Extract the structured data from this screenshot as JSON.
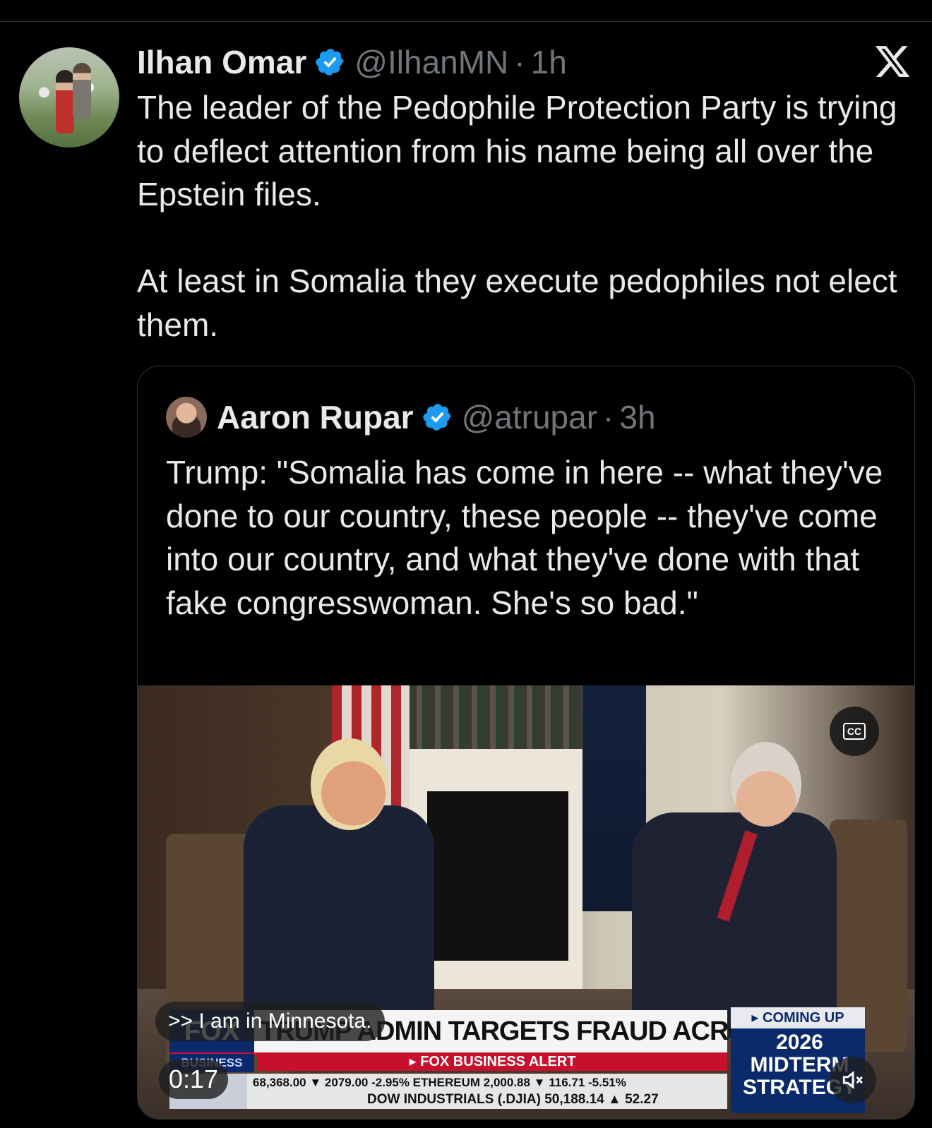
{
  "post": {
    "author_name": "Ilhan Omar",
    "author_handle": "@IlhanMN",
    "separator": "·",
    "time": "1h",
    "text_p1": "The leader of the Pedophile Protection Party is trying to deflect attention from his name being all over the Epstein files.",
    "text_p2": "At least in Somalia they execute pedophiles not elect them."
  },
  "quote": {
    "author_name": "Aaron Rupar",
    "author_handle": "@atrupar",
    "separator": "·",
    "time": "3h",
    "text": "Trump: \"Somalia has come in here -- what they've done to our country, these people -- they've come into our country, and what they've done with that fake congresswoman. She's so bad.\""
  },
  "video": {
    "caption": ">> I am in Minnesota.",
    "elapsed": "0:17",
    "cc_label": "CC",
    "chyron_logo": "FOX",
    "chyron_business": "BUSINESS",
    "chyron_headline": "TRUMP ADMIN TARGETS FRAUD ACROSS U.S.",
    "chyron_alert": "▸ FOX BUSINESS ALERT",
    "ticker_row1": "68,368.00 ▼ 2079.00 -2.95% ETHEREUM 2,000.88 ▼ 116.71 -5.51%",
    "ticker_row2": "DOW INDUSTRIALS (.DJIA) 50,188.14 ▲ 52.27",
    "promo_coming": "▸ COMING UP",
    "promo_title": "2026 MIDTERM STRATEGY"
  },
  "icons": {
    "verified": "verified-badge-icon",
    "brand": "x-logo-icon",
    "captions": "closed-captions-icon",
    "mute": "muted-speaker-icon"
  },
  "colors": {
    "background": "#000000",
    "text": "#e7e9ea",
    "muted": "#71767b",
    "verified": "#1d9bf0",
    "border": "#2f3336"
  }
}
